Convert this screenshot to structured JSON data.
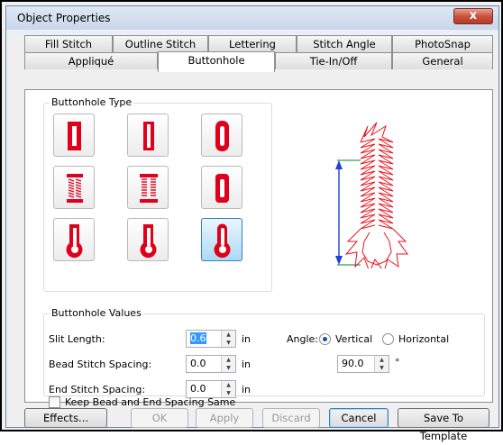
{
  "window": {
    "title": "Object Properties",
    "close_label": "x"
  },
  "tabs_row1": [
    "Fill Stitch",
    "Outline Stitch",
    "Lettering",
    "Stitch Angle",
    "PhotoSnap"
  ],
  "tabs_row2": [
    "Appliqué",
    "Buttonhole",
    "Tie-In/Off",
    "General"
  ],
  "active_tab": "Buttonhole",
  "buttonhole_type": {
    "label": "Buttonhole Type",
    "types": [
      "square-bar",
      "square-bar-thin",
      "rounded",
      "bar-tack",
      "bar-tack-dense",
      "rounded-square",
      "keyhole-wide",
      "keyhole",
      "keyhole-round"
    ],
    "selected_index": 8
  },
  "values": {
    "label": "Buttonhole Values",
    "slit_length": {
      "label": "Slit Length:",
      "value": "0.6",
      "unit": "in"
    },
    "bead_spacing": {
      "label": "Bead Stitch Spacing:",
      "value": "0.0",
      "unit": "in"
    },
    "end_spacing": {
      "label": "End Stitch Spacing:",
      "value": "0.0",
      "unit": "in"
    },
    "keep_same": {
      "label": "Keep Bead and End Spacing Same",
      "checked": false
    }
  },
  "angle": {
    "label": "Angle:",
    "vertical_label": "Vertical",
    "horizontal_label": "Horizontal",
    "selected": "Vertical",
    "value": "90.0",
    "unit": "°"
  },
  "buttons": {
    "effects": "Effects...",
    "ok": "OK",
    "apply": "Apply",
    "discard": "Discard",
    "cancel": "Cancel",
    "save_template": "Save To Template"
  },
  "colors": {
    "stitch_red": "#e0001b",
    "annotation_arrow": "#e8141c",
    "selection_blue": "#3399ff"
  }
}
